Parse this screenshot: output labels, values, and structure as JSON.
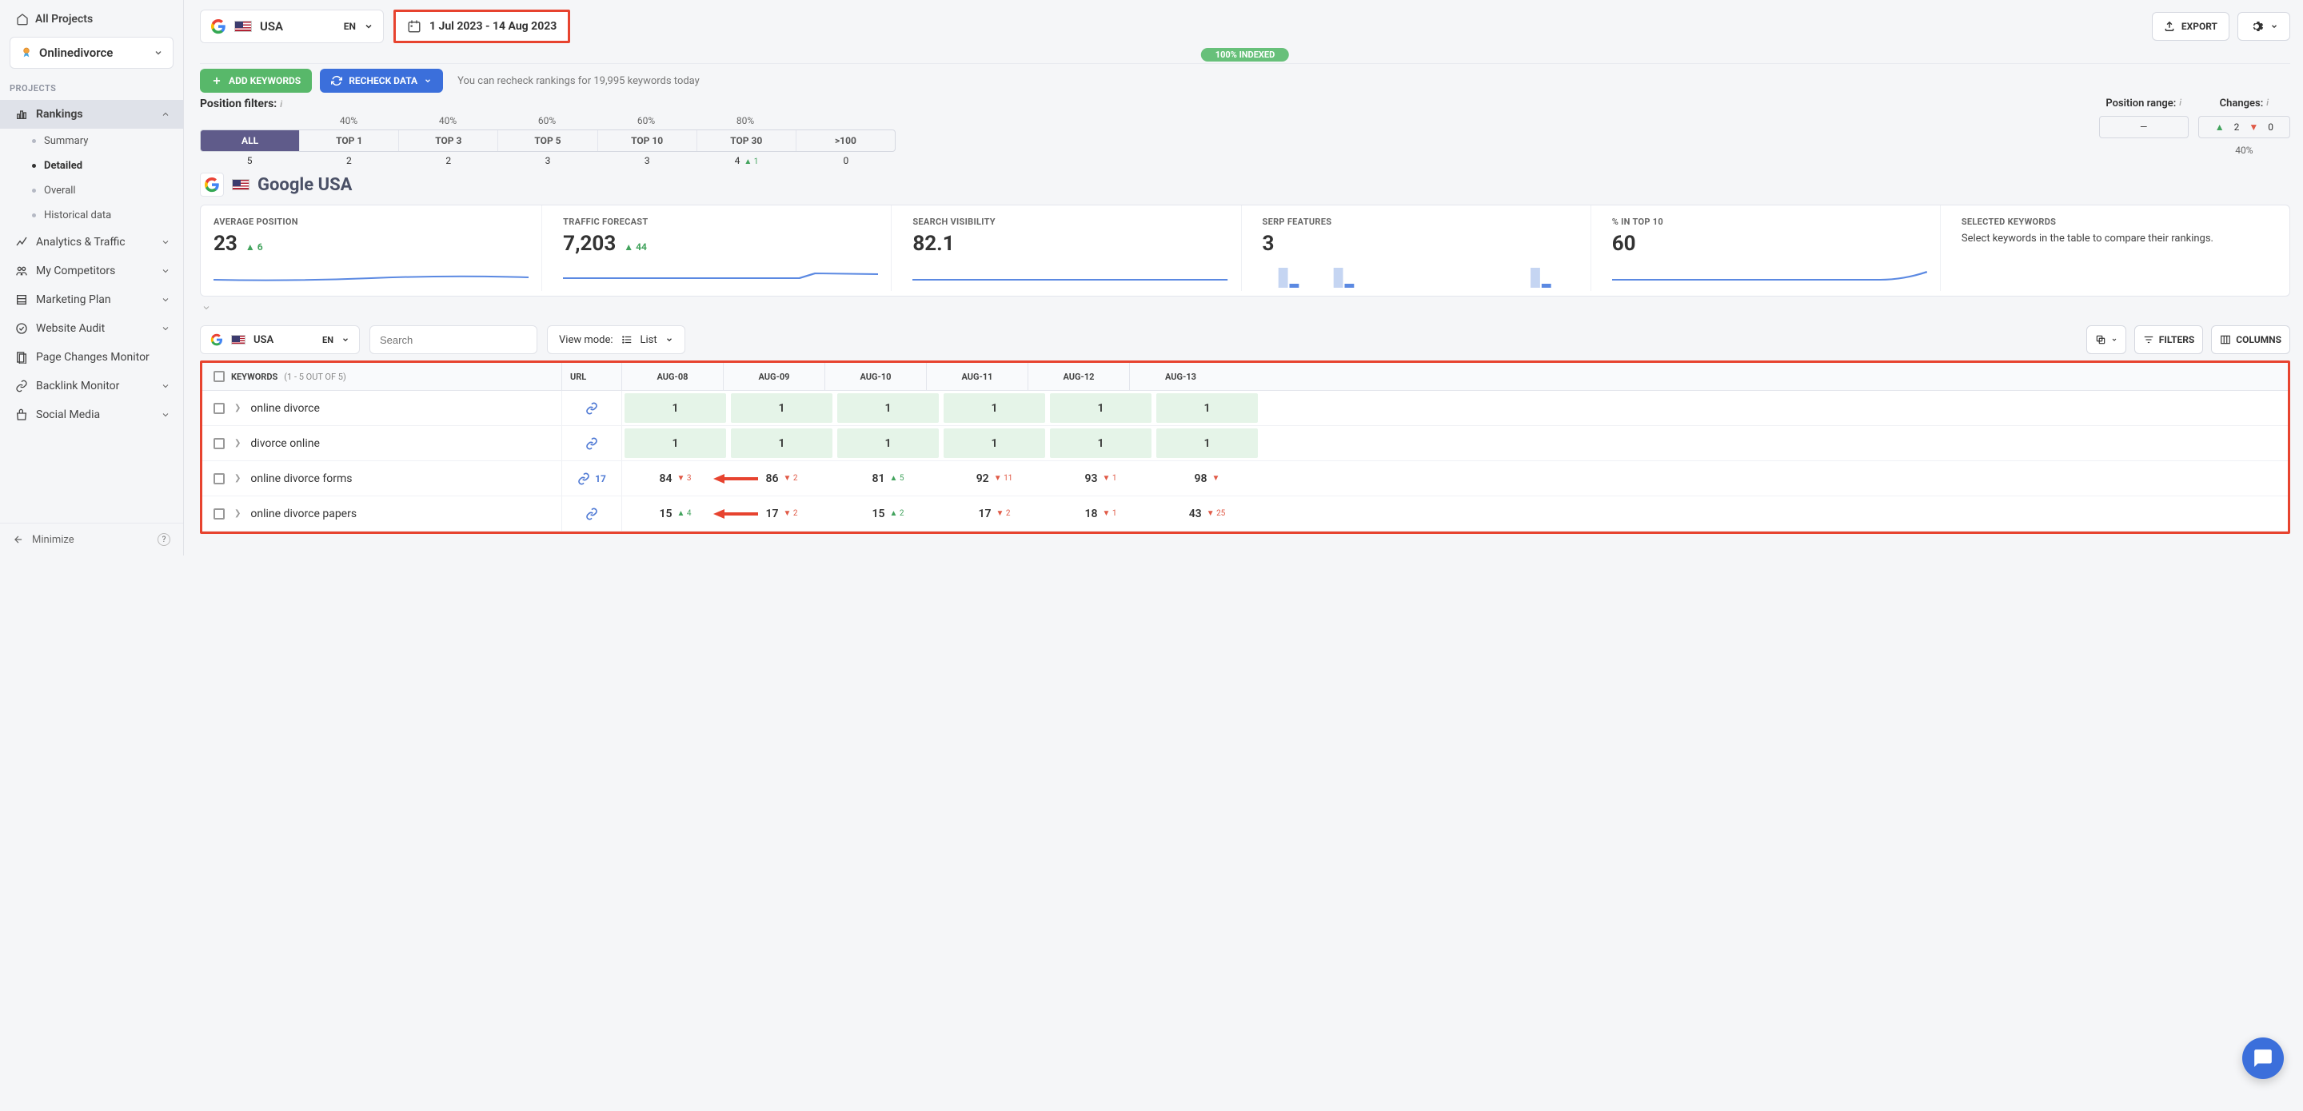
{
  "sidebar": {
    "all_projects": "All Projects",
    "project_name": "Onlinedivorce",
    "projects_label": "PROJECTS",
    "items": [
      {
        "label": "Rankings",
        "active": true,
        "sub": [
          {
            "label": "Summary"
          },
          {
            "label": "Detailed",
            "sel": true
          },
          {
            "label": "Overall"
          },
          {
            "label": "Historical data"
          }
        ]
      },
      {
        "label": "Analytics & Traffic"
      },
      {
        "label": "My Competitors"
      },
      {
        "label": "Marketing Plan"
      },
      {
        "label": "Website Audit"
      },
      {
        "label": "Page Changes Monitor"
      },
      {
        "label": "Backlink Monitor"
      },
      {
        "label": "Social Media"
      }
    ],
    "minimize": "Minimize"
  },
  "topbar": {
    "country": "USA",
    "lang": "EN",
    "date_range": "1 Jul 2023 - 14 Aug 2023",
    "export": "EXPORT"
  },
  "indexed": "100% INDEXED",
  "buttons": {
    "add_keywords": "ADD KEYWORDS",
    "recheck": "RECHECK DATA",
    "recheck_note": "You can recheck rankings for 19,995 keywords today"
  },
  "filters": {
    "label": "Position filters:",
    "shares": [
      "40%",
      "40%",
      "60%",
      "60%",
      "80%"
    ],
    "segments": [
      {
        "name": "ALL",
        "count": "5",
        "active": true
      },
      {
        "name": "TOP 1",
        "count": "2"
      },
      {
        "name": "TOP 3",
        "count": "2"
      },
      {
        "name": "TOP 5",
        "count": "3"
      },
      {
        "name": "TOP 10",
        "count": "3"
      },
      {
        "name": "TOP 30",
        "count": "4",
        "cdelta": "1",
        "cdir": "up"
      },
      {
        "name": ">100",
        "count": "0"
      }
    ],
    "pos_range_label": "Position range:",
    "pos_range_val": "—",
    "changes_label": "Changes:",
    "changes_up": "2",
    "changes_down": "0",
    "changes_pct": "40%"
  },
  "gtitle": "Google USA",
  "stats": {
    "avg_pos": {
      "label": "AVERAGE POSITION",
      "value": "23",
      "delta": "6",
      "dir": "up"
    },
    "traffic": {
      "label": "TRAFFIC FORECAST",
      "value": "7,203",
      "delta": "44",
      "dir": "up"
    },
    "visibility": {
      "label": "SEARCH VISIBILITY",
      "value": "82.1"
    },
    "serp": {
      "label": "SERP FEATURES",
      "value": "3"
    },
    "top10": {
      "label": "% IN TOP 10",
      "value": "60"
    },
    "selected": {
      "label": "SELECTED KEYWORDS",
      "text": "Select keywords in the table to compare their rankings."
    }
  },
  "table_toolbar": {
    "country": "USA",
    "lang": "EN",
    "search_ph": "Search",
    "viewmode_lbl": "View mode:",
    "viewmode_val": "List",
    "filters": "FILTERS",
    "columns": "COLUMNS"
  },
  "table": {
    "kw_header": "KEYWORDS",
    "kw_count": "(1 - 5 OUT OF 5)",
    "url_header": "URL",
    "dates": [
      "AUG-08",
      "AUG-09",
      "AUG-10",
      "AUG-11",
      "AUG-12",
      "AUG-13"
    ],
    "rows": [
      {
        "kw": "online divorce",
        "url_count": "",
        "cells": [
          {
            "v": "1",
            "g": true
          },
          {
            "v": "1",
            "g": true
          },
          {
            "v": "1",
            "g": true
          },
          {
            "v": "1",
            "g": true
          },
          {
            "v": "1",
            "g": true
          },
          {
            "v": "1",
            "g": true
          }
        ]
      },
      {
        "kw": "divorce online",
        "url_count": "",
        "cells": [
          {
            "v": "1",
            "g": true
          },
          {
            "v": "1",
            "g": true
          },
          {
            "v": "1",
            "g": true
          },
          {
            "v": "1",
            "g": true
          },
          {
            "v": "1",
            "g": true
          },
          {
            "v": "1",
            "g": true
          }
        ]
      },
      {
        "kw": "online divorce forms",
        "url_count": "17",
        "arrow_after": 0,
        "cells": [
          {
            "v": "84",
            "d": "3",
            "dir": "down"
          },
          {
            "v": "86",
            "d": "2",
            "dir": "down"
          },
          {
            "v": "81",
            "d": "5",
            "dir": "up"
          },
          {
            "v": "92",
            "d": "11",
            "dir": "down"
          },
          {
            "v": "93",
            "d": "1",
            "dir": "down"
          },
          {
            "v": "98",
            "d": "",
            "dir": "down"
          }
        ]
      },
      {
        "kw": "online divorce papers",
        "url_count": "",
        "arrow_after": 0,
        "cells": [
          {
            "v": "15",
            "d": "4",
            "dir": "up"
          },
          {
            "v": "17",
            "d": "2",
            "dir": "down"
          },
          {
            "v": "15",
            "d": "2",
            "dir": "up"
          },
          {
            "v": "17",
            "d": "2",
            "dir": "down"
          },
          {
            "v": "18",
            "d": "1",
            "dir": "down"
          },
          {
            "v": "43",
            "d": "25",
            "dir": "down"
          }
        ]
      }
    ]
  }
}
